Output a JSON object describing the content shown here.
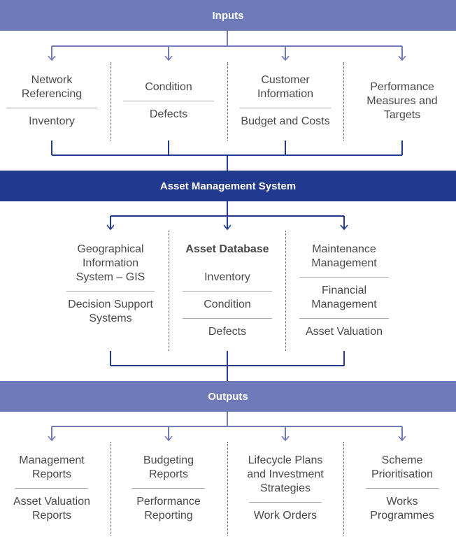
{
  "colors": {
    "light_band": "#6f7bb9",
    "dark_band": "#213a8f",
    "text": "#4a4a4a"
  },
  "inputs": {
    "title": "Inputs",
    "columns": [
      {
        "items": [
          "Network Referencing",
          "Inventory"
        ]
      },
      {
        "items": [
          "Condition",
          "Defects"
        ]
      },
      {
        "items": [
          "Customer Information",
          "Budget and Costs"
        ]
      },
      {
        "items": [
          "Performance Measures and Targets"
        ]
      }
    ]
  },
  "system": {
    "title": "Asset Management System",
    "columns": [
      {
        "items": [
          "Geographical Information System – GIS",
          "Decision Support Systems"
        ]
      },
      {
        "heading": "Asset Database",
        "items": [
          "Inventory",
          "Condition",
          "Defects"
        ]
      },
      {
        "items": [
          "Maintenance Management",
          "Financial Management",
          "Asset Valuation"
        ]
      }
    ]
  },
  "outputs": {
    "title": "Outputs",
    "columns": [
      {
        "items": [
          "Management Reports",
          "Asset Valuation Reports"
        ]
      },
      {
        "items": [
          "Budgeting Reports",
          "Performance Reporting"
        ]
      },
      {
        "items": [
          "Lifecycle Plans and Investment Strategies",
          "Work Orders"
        ]
      },
      {
        "items": [
          "Scheme Prioritisation",
          "Works Programmes"
        ]
      }
    ]
  }
}
